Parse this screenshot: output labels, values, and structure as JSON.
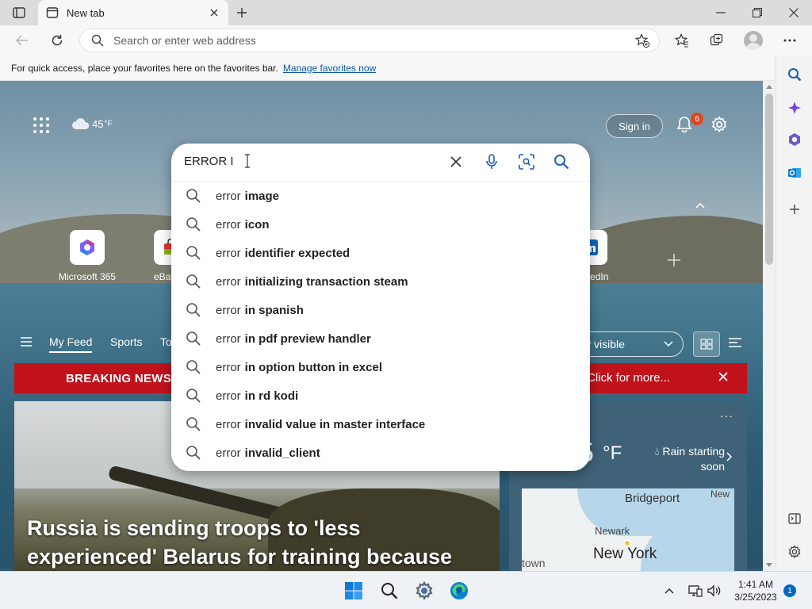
{
  "browser": {
    "tab_title": "New tab",
    "address_placeholder": "Search or enter web address",
    "favorites_bar_text": "For quick access, place your favorites here on the favorites bar.",
    "favorites_bar_link": "Manage favorites now"
  },
  "newtab": {
    "weather_temp": "45",
    "weather_unit": "°F",
    "signin_label": "Sign in",
    "notification_count": "6",
    "quick_links": [
      {
        "label": "Microsoft 365",
        "icon": "microsoft365-icon"
      },
      {
        "label": "eBay",
        "icon": "ebay-icon"
      },
      {
        "label": "LinkedIn",
        "icon": "linkedin-icon"
      }
    ],
    "feed": {
      "my_feed": "My Feed",
      "sports": "Sports",
      "partial_tab": "To",
      "visibility_label": "ly visible"
    },
    "breaking": {
      "label": "BREAKING NEWS",
      "more": "Click for more..."
    },
    "hero_headline": "Russia is sending troops to 'less experienced' Belarus for training because most of its own",
    "weather_card": {
      "temp": "5",
      "unit": "°F",
      "rain": "Rain starting soon",
      "map_labels": {
        "bridgeport": "Bridgeport",
        "newark": "Newark",
        "new_york": "New York",
        "town": "town",
        "new": "New"
      }
    }
  },
  "search": {
    "query": "ERROR I",
    "suggestions": [
      {
        "prefix": "error",
        "bold": "image"
      },
      {
        "prefix": "error",
        "bold": "icon"
      },
      {
        "prefix": "error",
        "bold": "identifier expected"
      },
      {
        "prefix": "error",
        "bold": "initializing transaction steam"
      },
      {
        "prefix": "error",
        "bold": "in spanish"
      },
      {
        "prefix": "error",
        "bold": "in pdf preview handler"
      },
      {
        "prefix": "error",
        "bold": "in option button in excel"
      },
      {
        "prefix": "error",
        "bold": "in rd kodi"
      },
      {
        "prefix": "error",
        "bold": "invalid value in master interface"
      },
      {
        "prefix": "error",
        "bold": "invalid_client"
      }
    ]
  },
  "taskbar": {
    "time": "1:41 AM",
    "date": "3/25/2023",
    "notification_count": "1"
  },
  "colors": {
    "breaking_red": "#c1121c",
    "accent_blue": "#0067c0",
    "link_blue": "#0b57a5"
  }
}
